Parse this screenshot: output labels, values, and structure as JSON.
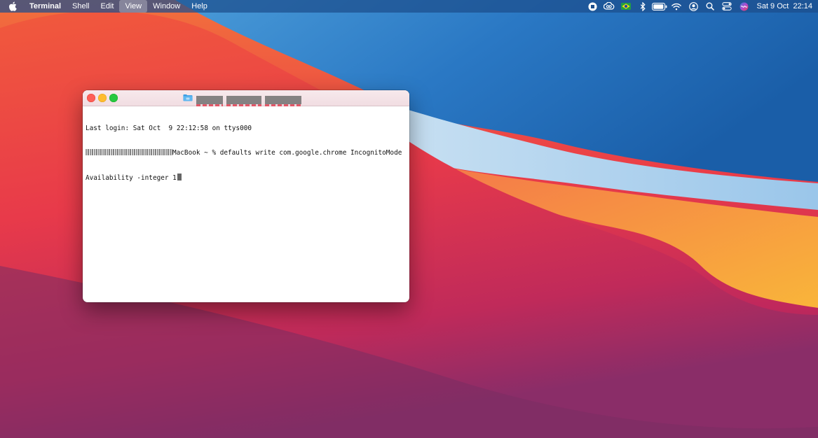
{
  "menubar": {
    "apple_icon": "apple-logo-icon",
    "app_name": "Terminal",
    "items": [
      "Shell",
      "Edit",
      "View",
      "Window",
      "Help"
    ],
    "active_item": "View",
    "status_icons": [
      "screen-record-stop-icon",
      "creative-cloud-icon",
      "brazil-flag-icon",
      "bluetooth-icon",
      "battery-icon",
      "wifi-icon",
      "user-account-icon",
      "spotlight-search-icon",
      "control-center-icon",
      "siri-icon"
    ],
    "clock": {
      "date": "Sat 9 Oct",
      "time": "22:14"
    }
  },
  "terminal": {
    "folder_icon": "folder-icon",
    "lines": [
      "Last login: Sat Oct  9 22:12:58 on ttys000",
      "MacBook ~ % defaults write com.google.chrome IncognitoMode",
      "Availability -integer 1"
    ]
  },
  "colors": {
    "menubar": "#1c4e8c",
    "traffic_close": "#fe5f57",
    "traffic_minimize": "#febc2e",
    "traffic_zoom": "#28c840",
    "redaction_underline": "#e03a4e"
  }
}
